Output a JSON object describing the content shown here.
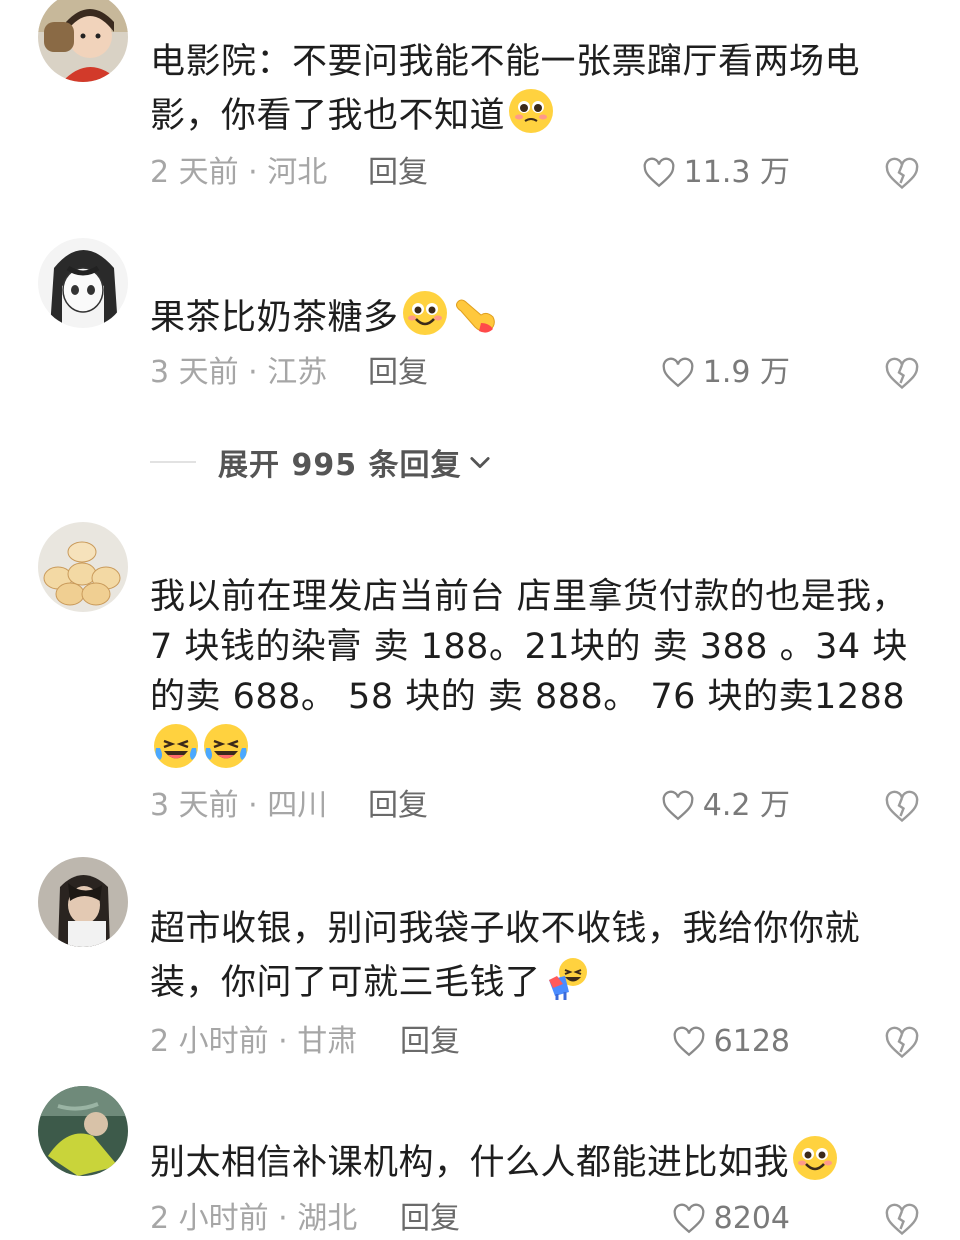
{
  "comments": [
    {
      "text": "电影院：不要问我能不能一张票蹿厅看两场电影，你看了我也不知道",
      "emojis": [
        "pleading-face-emoji"
      ],
      "time_location": "2 天前 · 河北",
      "reply_label": "回复",
      "likes": "11.3 万"
    },
    {
      "text": "果茶比奶茶糖多",
      "emojis": [
        "smiling-face-emoji",
        "pointing-hand-emoji"
      ],
      "time_location": "3 天前 · 江苏",
      "reply_label": "回复",
      "likes": "1.9 万"
    },
    {
      "text": "我以前在理发店当前台 店里拿货付款的也是我，7 块钱的染膏 卖 188。21块的 卖 388 。34 块的卖 688。 58 块的 卖 888。 76 块的卖1288",
      "emojis": [
        "laughing-tears-emoji",
        "laughing-tears-emoji"
      ],
      "time_location": "3 天前 · 四川",
      "reply_label": "回复",
      "likes": "4.2 万"
    },
    {
      "text": "超市收银，别问我袋子收不收钱，我给你你就装，你问了可就三毛钱了",
      "emojis": [
        "laughing-bow-emoji"
      ],
      "time_location": "2 小时前 · 甘肃",
      "reply_label": "回复",
      "likes": "6128"
    },
    {
      "text": "别太相信补课机构，什么人都能进比如我",
      "emojis": [
        "smiling-face-emoji"
      ],
      "time_location": "2 小时前 · 湖北",
      "reply_label": "回复",
      "likes": "8204"
    }
  ],
  "expand_replies": "展开 995 条回复",
  "colors": {
    "meta": "#a6a6a6",
    "reply": "#6a6a6a",
    "text": "#1e1e1e",
    "like": "#7a7a7a"
  }
}
